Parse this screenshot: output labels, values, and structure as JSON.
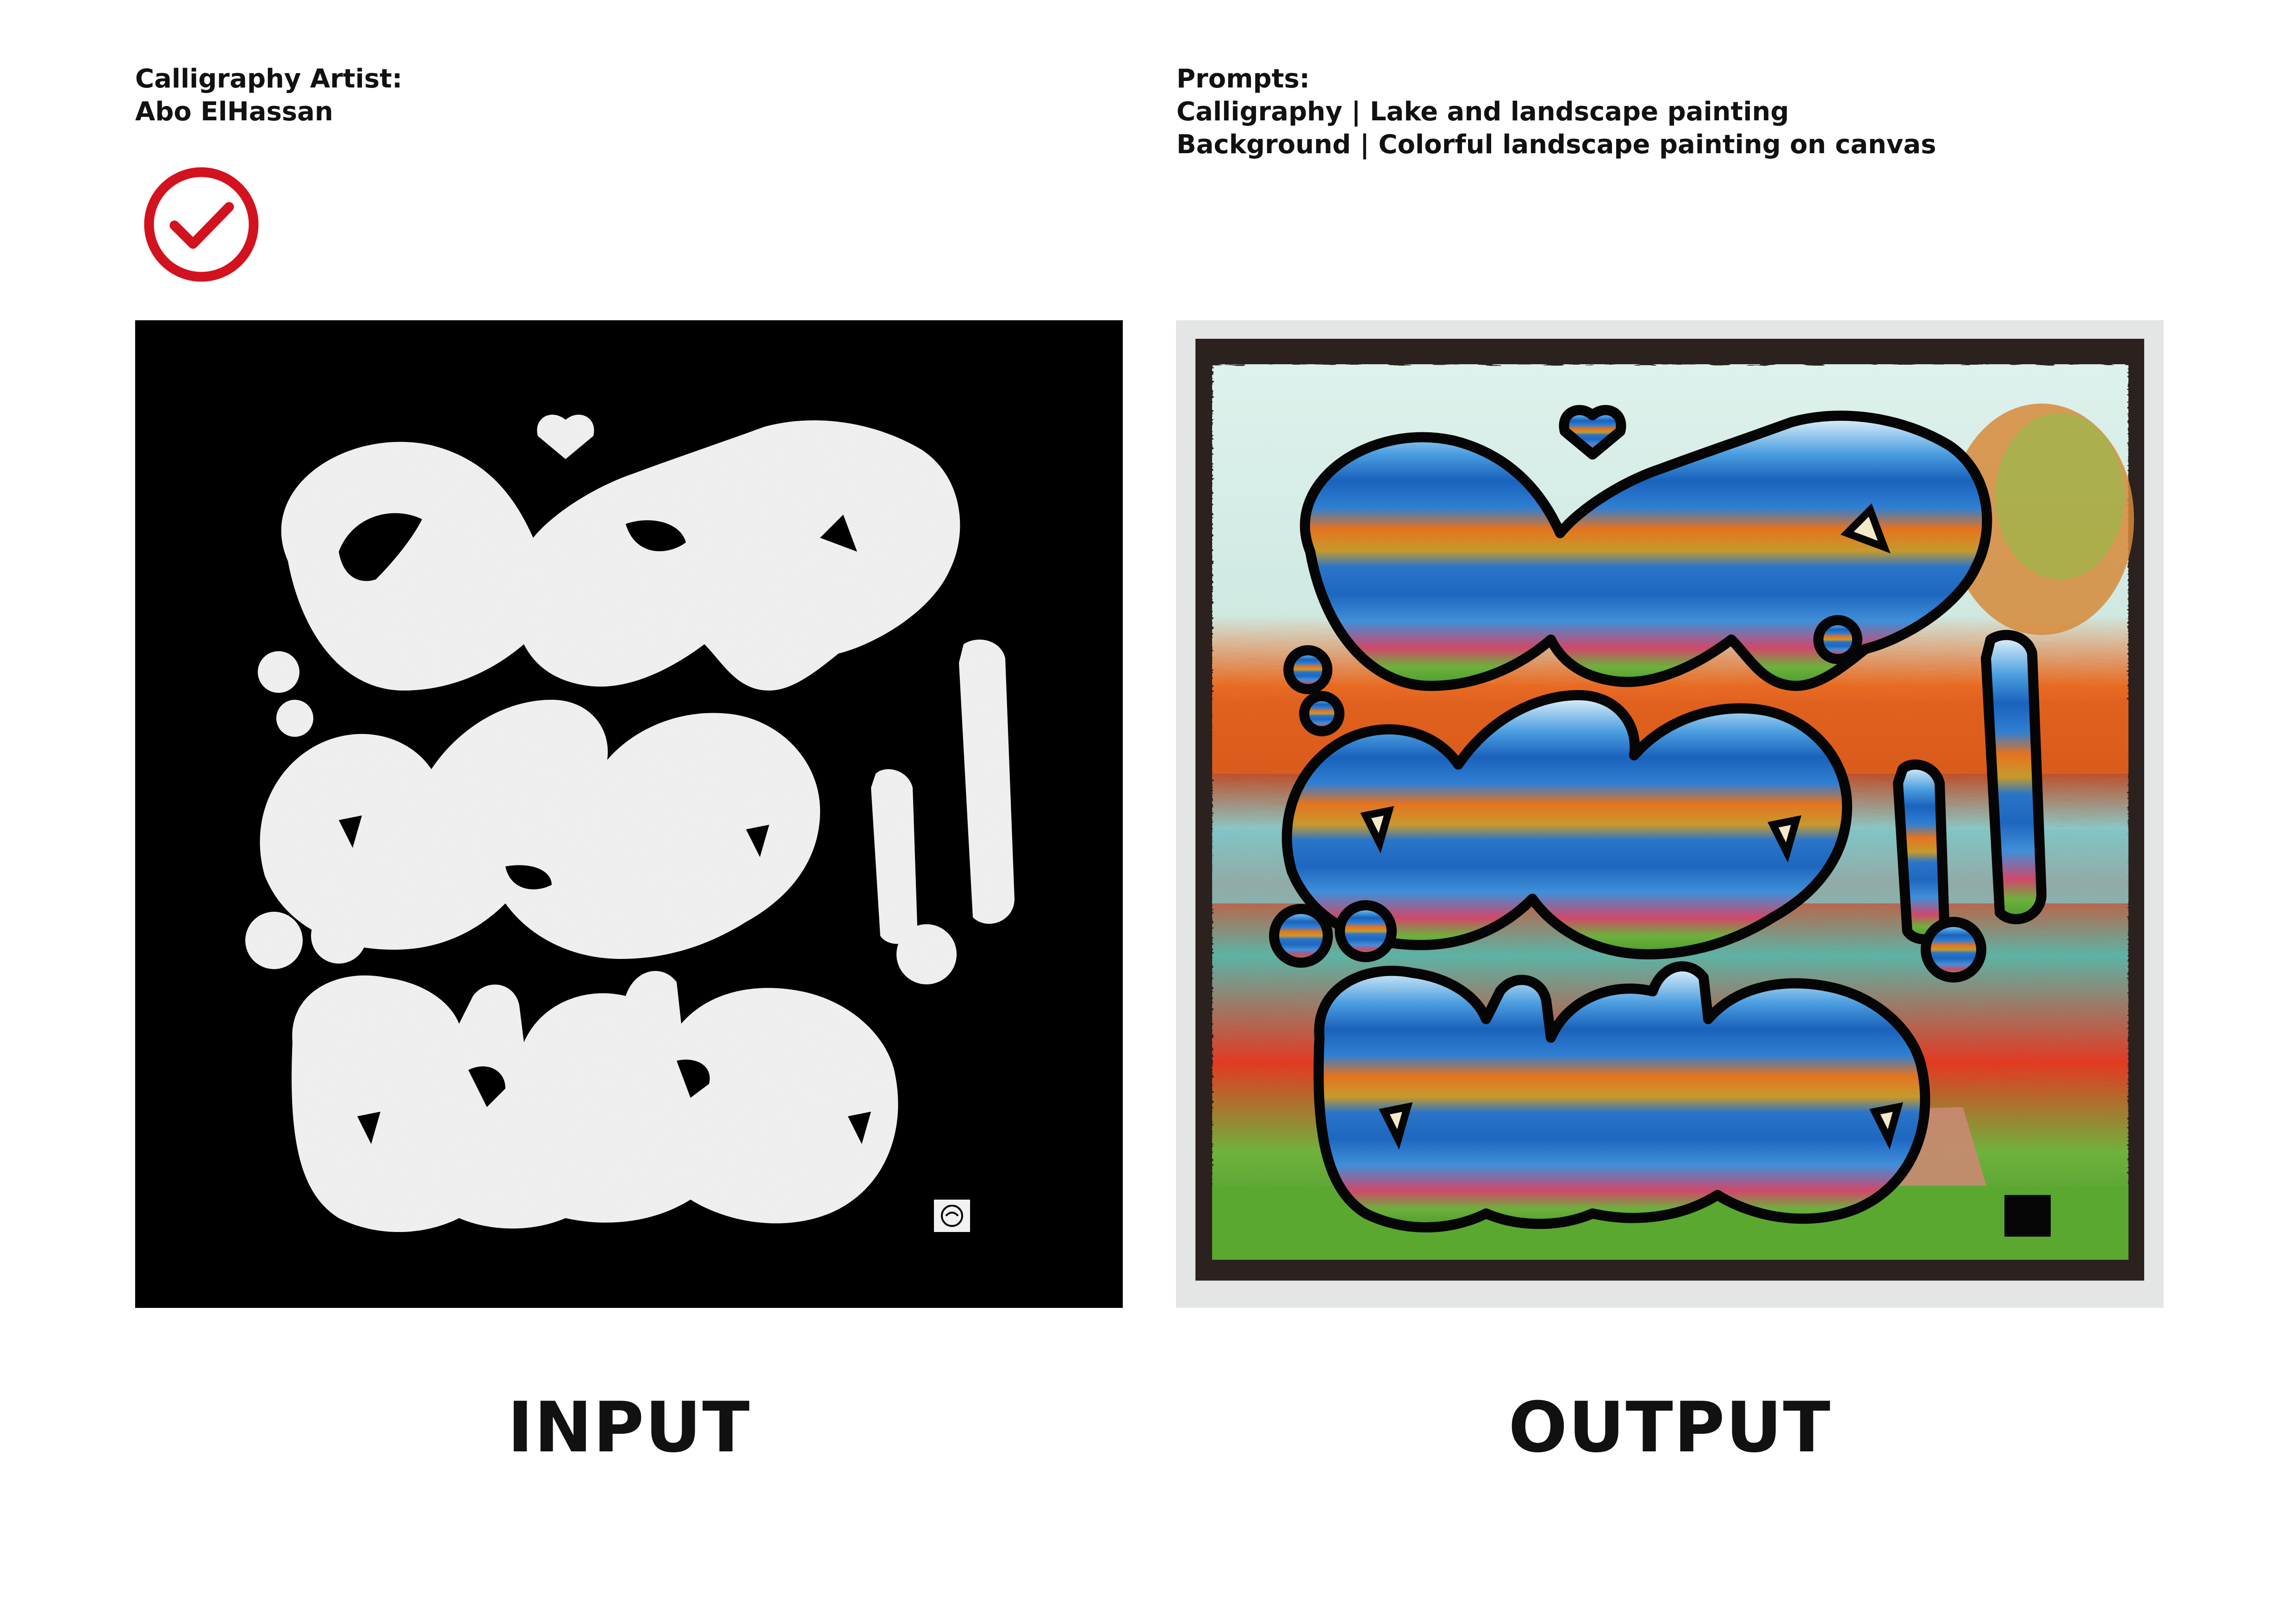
{
  "artist": {
    "heading": "Calligraphy Artist:",
    "name": "Abo ElHassan"
  },
  "prompts": {
    "heading": "Prompts:",
    "calligraphy": "Calligraphy | Lake and landscape painting",
    "background": "Background | Colorful landscape painting on canvas"
  },
  "status": {
    "icon": "checkmark-circle-icon",
    "color": "#d3121f"
  },
  "panels": {
    "input_label": "INPUT",
    "output_label": "OUTPUT"
  },
  "artwork": {
    "input_colors": {
      "background": "#000000",
      "letters": "#f2f2f2"
    },
    "output_colors": {
      "frame": "#2b2220",
      "sky": "#dff1ec",
      "water_blue": "#1f6fc4",
      "autumn_orange": "#e4691c",
      "grass_green": "#5aa830",
      "outline": "#050505"
    }
  }
}
